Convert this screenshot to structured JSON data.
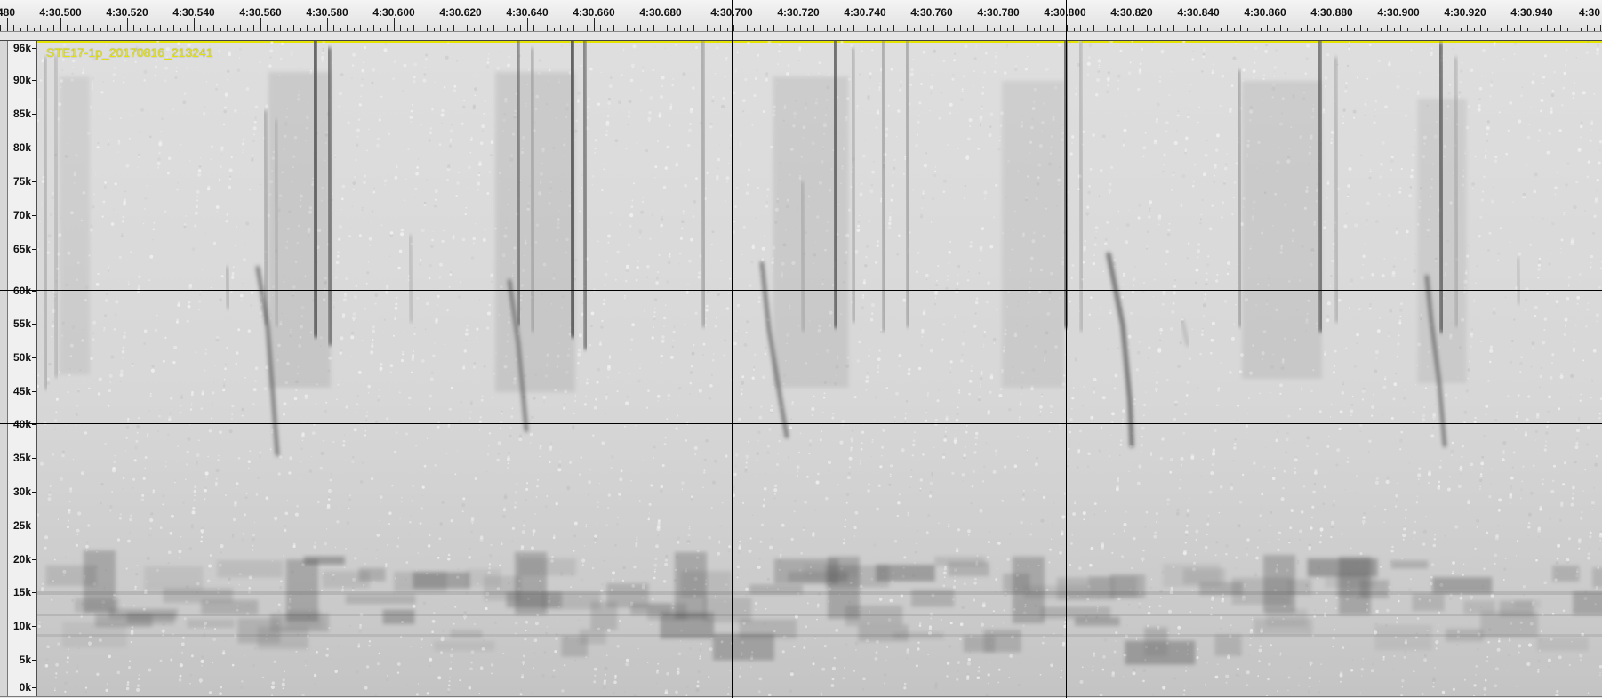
{
  "timeline": {
    "labels": [
      "480",
      "4:30.500",
      "4:30.520",
      "4:30.540",
      "4:30.560",
      "4:30.580",
      "4:30.600",
      "4:30.620",
      "4:30.640",
      "4:30.660",
      "4:30.680",
      "4:30.700",
      "4:30.720",
      "4:30.740",
      "4:30.760",
      "4:30.780",
      "4:30.800",
      "4:30.820",
      "4:30.840",
      "4:30.860",
      "4:30.880",
      "4:30.900",
      "4:30.920",
      "4:30.940",
      "4:30"
    ]
  },
  "track": {
    "clip_name": "STE17-1p_20170816_213241"
  },
  "frequency_axis": {
    "labels": [
      "96k",
      "90k",
      "85k",
      "80k",
      "75k",
      "70k",
      "65k",
      "60k",
      "55k",
      "50k",
      "45k",
      "40k",
      "35k",
      "30k",
      "25k",
      "20k",
      "15k",
      "10k",
      "5k",
      "0k"
    ]
  },
  "spectrogram": {
    "background_color": "#d7d7d7",
    "noise_color": "#f4f4f4",
    "dark_signal_color": "#555555",
    "medium_signal_color": "#8a8a8a"
  }
}
